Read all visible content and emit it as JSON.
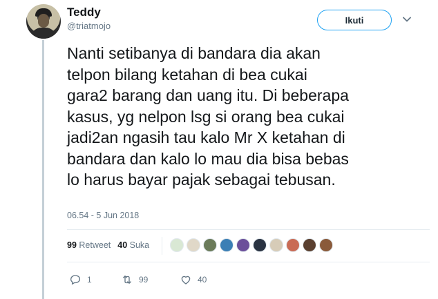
{
  "tweet": {
    "author_name": "Teddy",
    "author_handle": "@triatmojo",
    "follow_label": "Ikuti",
    "text": "Nanti setibanya di bandara dia akan\ntelpon bilang ketahan di bea cukai\ngara2 barang dan uang itu. Di beberapa\nkasus, yg nelpon lsg si orang bea cukai\njadi2an ngasih tau kalo Mr X ketahan di\nbandara dan kalo lo mau dia bisa bebas\nlo harus bayar pajak sebagai tebusan.",
    "timestamp": "06.54 - 5 Jun 2018"
  },
  "stats": {
    "retweet_count": "99",
    "retweet_label": "Retweet",
    "like_count": "40",
    "like_label": "Suka"
  },
  "likers": [
    {
      "icon": "avatar",
      "color": "#d9e8d4"
    },
    {
      "icon": "avatar",
      "color": "#e0d8c8"
    },
    {
      "icon": "avatar",
      "color": "#6b7b5a"
    },
    {
      "icon": "avatar",
      "color": "#3b7fb5"
    },
    {
      "icon": "avatar",
      "color": "#6b4f9a"
    },
    {
      "icon": "avatar",
      "color": "#2a3342"
    },
    {
      "icon": "avatar",
      "color": "#d7ccb8"
    },
    {
      "icon": "avatar",
      "color": "#c96b55"
    },
    {
      "icon": "avatar",
      "color": "#5a4030"
    },
    {
      "icon": "avatar",
      "color": "#8a5a3a"
    }
  ],
  "actions": {
    "reply_count": "1",
    "retweet_count": "99",
    "like_count": "40"
  },
  "colors": {
    "accent": "#1da1f2",
    "muted": "#657786",
    "text": "#14171a"
  }
}
